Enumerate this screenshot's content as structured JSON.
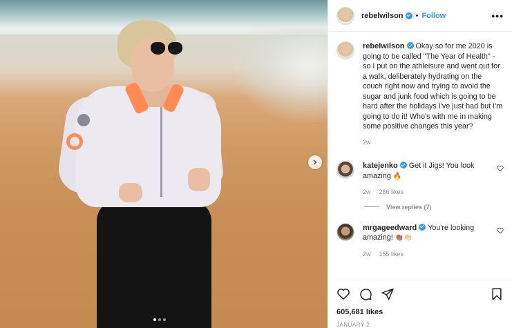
{
  "post": {
    "author": "rebelwilson",
    "follow_label": "Follow",
    "separator": "•",
    "more_label": "•••"
  },
  "caption": {
    "username": "rebelwilson",
    "text": "Okay so for me 2020 is going to be called \"The Year of Health\" - so I put on the athleisure and went out for a walk, deliberately hydrating on the couch right now and trying to avoid the sugar and junk food which is going to be hard after the holidays I've just had but I'm going to do it! Who's with me in making some positive changes this year?",
    "age": "2w"
  },
  "comments": [
    {
      "username": "katejenko",
      "text": "Get it Jigs! You look amazing",
      "emoji": "🔥",
      "age": "2w",
      "likes": "286 likes",
      "view_replies": "View replies (7)"
    },
    {
      "username": "mrgageedward",
      "text": "You're looking amazing!",
      "emoji": "👏🏽👏🏻",
      "age": "2w",
      "likes": "155 likes"
    }
  ],
  "likes_count": "605,681 likes",
  "date": "JANUARY 2",
  "carousel": {
    "total": 3,
    "active": 1
  },
  "icons": {
    "like": "heart-icon",
    "comment": "comment-icon",
    "share": "share-icon",
    "save": "bookmark-icon",
    "next": "chevron-right-icon"
  },
  "colors": {
    "accent": "#3897f0",
    "muted": "#8e8e8e",
    "text": "#262626"
  }
}
